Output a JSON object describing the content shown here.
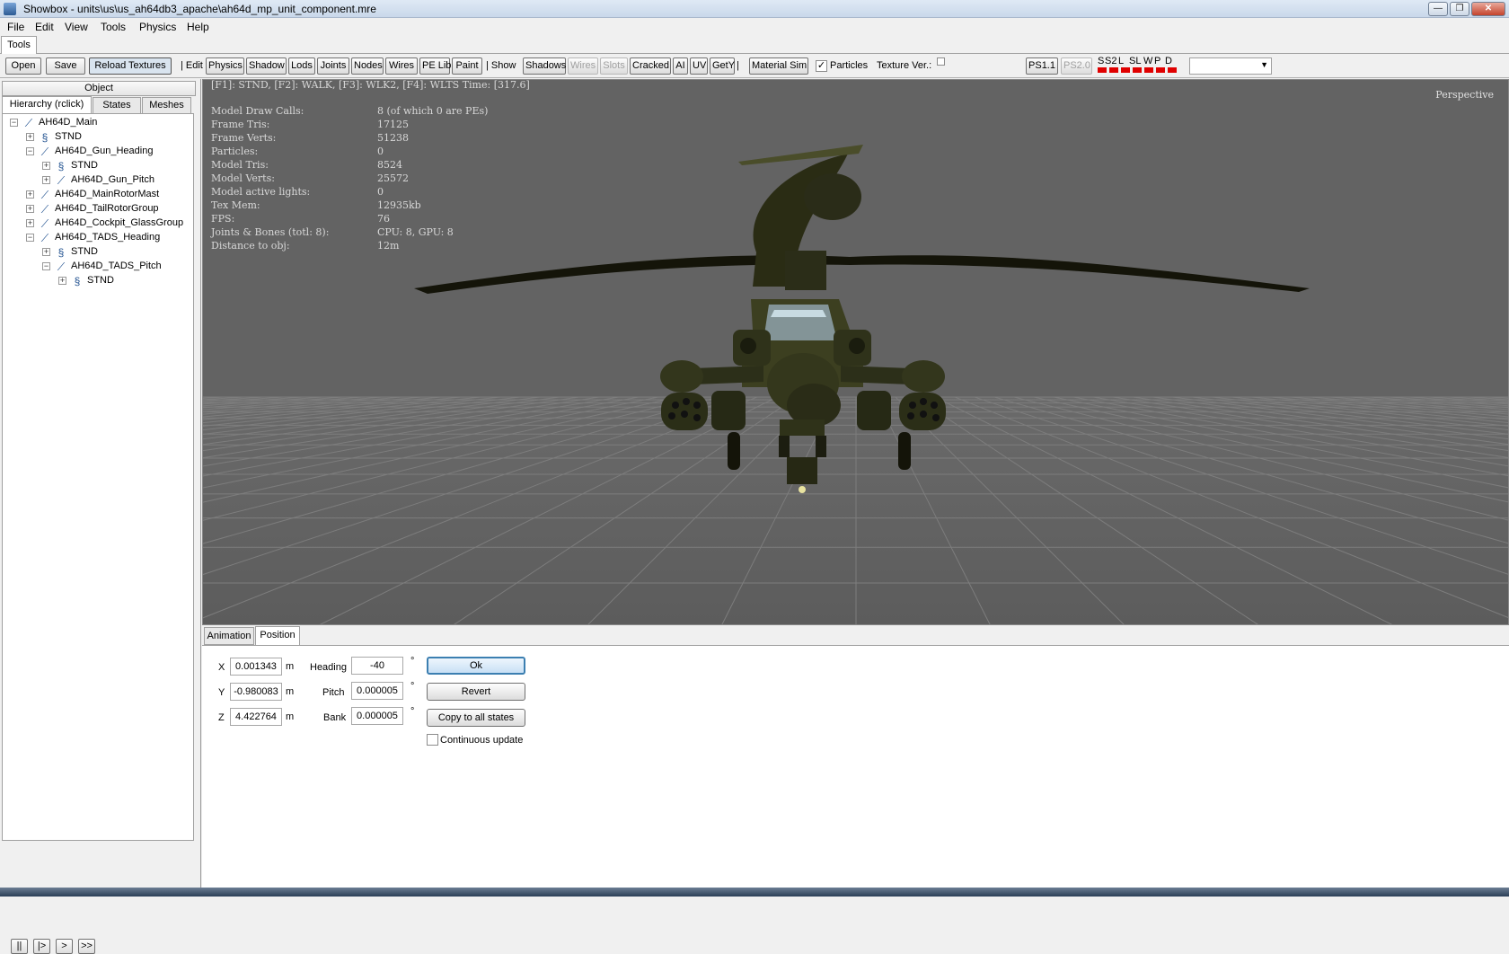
{
  "window": {
    "title": "Showbox - units\\us\\us_ah64db3_apache\\ah64d_mp_unit_component.mre",
    "controls": [
      "—",
      "❐",
      "✕"
    ]
  },
  "menu": [
    "File",
    "Edit",
    "View",
    "Tools",
    "Physics",
    "Help"
  ],
  "tools_tab": "Tools",
  "toolbar": {
    "open": "Open",
    "save": "Save",
    "reload": "Reload Textures",
    "edit_label": "| Edit",
    "edit_buttons": [
      "Physics",
      "Shadow",
      "Lods",
      "Joints",
      "Nodes",
      "Wires",
      "PE Lib",
      "Paint"
    ],
    "show_label": "| Show",
    "show_buttons": [
      "Shadows",
      "Wires",
      "Slots",
      "Cracked",
      "AI",
      "UV",
      "GetY"
    ],
    "sep": "|",
    "material_sim": "Material Sim",
    "particles_label": "Particles",
    "particles_checked": true,
    "texture_ver": "Texture Ver.:",
    "ps11": "PS1.1",
    "ps20": "PS2.0",
    "indicators": [
      "S",
      "S2",
      "L",
      "SL",
      "W",
      "P",
      "D"
    ],
    "indicator_color": "#e00000",
    "dropdown_value": ""
  },
  "left": {
    "object_header": "Object",
    "tabs": [
      "Hierarchy (rclick)",
      "States",
      "Meshes"
    ],
    "tree": [
      {
        "label": "AH64D_Main",
        "level": 0,
        "exp": "−",
        "icon": "joint-icon"
      },
      {
        "label": "STND",
        "level": 1,
        "exp": "+",
        "icon": "state-icon"
      },
      {
        "label": "AH64D_Gun_Heading",
        "level": 1,
        "exp": "−",
        "icon": "joint-icon"
      },
      {
        "label": "STND",
        "level": 2,
        "exp": "+",
        "icon": "state-icon"
      },
      {
        "label": "AH64D_Gun_Pitch",
        "level": 2,
        "exp": "+",
        "icon": "joint-icon"
      },
      {
        "label": "AH64D_MainRotorMast",
        "level": 1,
        "exp": "+",
        "icon": "joint-icon"
      },
      {
        "label": "AH64D_TailRotorGroup",
        "level": 1,
        "exp": "+",
        "icon": "joint-icon"
      },
      {
        "label": "AH64D_Cockpit_GlassGroup",
        "level": 1,
        "exp": "+",
        "icon": "joint-icon"
      },
      {
        "label": "AH64D_TADS_Heading",
        "level": 1,
        "exp": "−",
        "icon": "joint-icon"
      },
      {
        "label": "STND",
        "level": 2,
        "exp": "+",
        "icon": "state-icon"
      },
      {
        "label": "AH64D_TADS_Pitch",
        "level": 2,
        "exp": "−",
        "icon": "joint-icon"
      },
      {
        "label": "STND",
        "level": 3,
        "exp": "+",
        "icon": "state-icon"
      }
    ],
    "playback": [
      "||",
      "|>",
      ">",
      ">>"
    ]
  },
  "viewport": {
    "hotkeys": "[F1]: STND, [F2]: WALK, [F3]: WLK2, [F4]: WLTS Time: [317.6]",
    "perspective": "Perspective",
    "stats": [
      {
        "k": "Model Draw Calls:",
        "v": "8 (of which 0 are PEs)"
      },
      {
        "k": "Frame Tris:",
        "v": "17125"
      },
      {
        "k": "Frame Verts:",
        "v": "51238"
      },
      {
        "k": "Particles:",
        "v": "0"
      },
      {
        "k": "Model Tris:",
        "v": "8524"
      },
      {
        "k": "Model Verts:",
        "v": "25572"
      },
      {
        "k": "Model active lights:",
        "v": "0"
      },
      {
        "k": "Tex Mem:",
        "v": "12935kb"
      },
      {
        "k": "FPS:",
        "v": "76"
      },
      {
        "k": "Joints & Bones (totl: 8):",
        "v": "CPU: 8, GPU: 8"
      },
      {
        "k": "Distance to obj:",
        "v": "12m"
      }
    ]
  },
  "bottom": {
    "tabs": [
      "Animation",
      "Position"
    ],
    "x_label": "X",
    "x": "0.001343",
    "y_label": "Y",
    "y": "-0.980083",
    "z_label": "Z",
    "z": "4.422764",
    "unit": "m",
    "heading_label": "Heading",
    "heading": "-40",
    "pitch_label": "Pitch",
    "pitch": "0.000005",
    "bank_label": "Bank",
    "bank": "0.000005",
    "deg": "°",
    "ok": "Ok",
    "revert": "Revert",
    "copy": "Copy to all states",
    "continuous": "Continuous update"
  }
}
